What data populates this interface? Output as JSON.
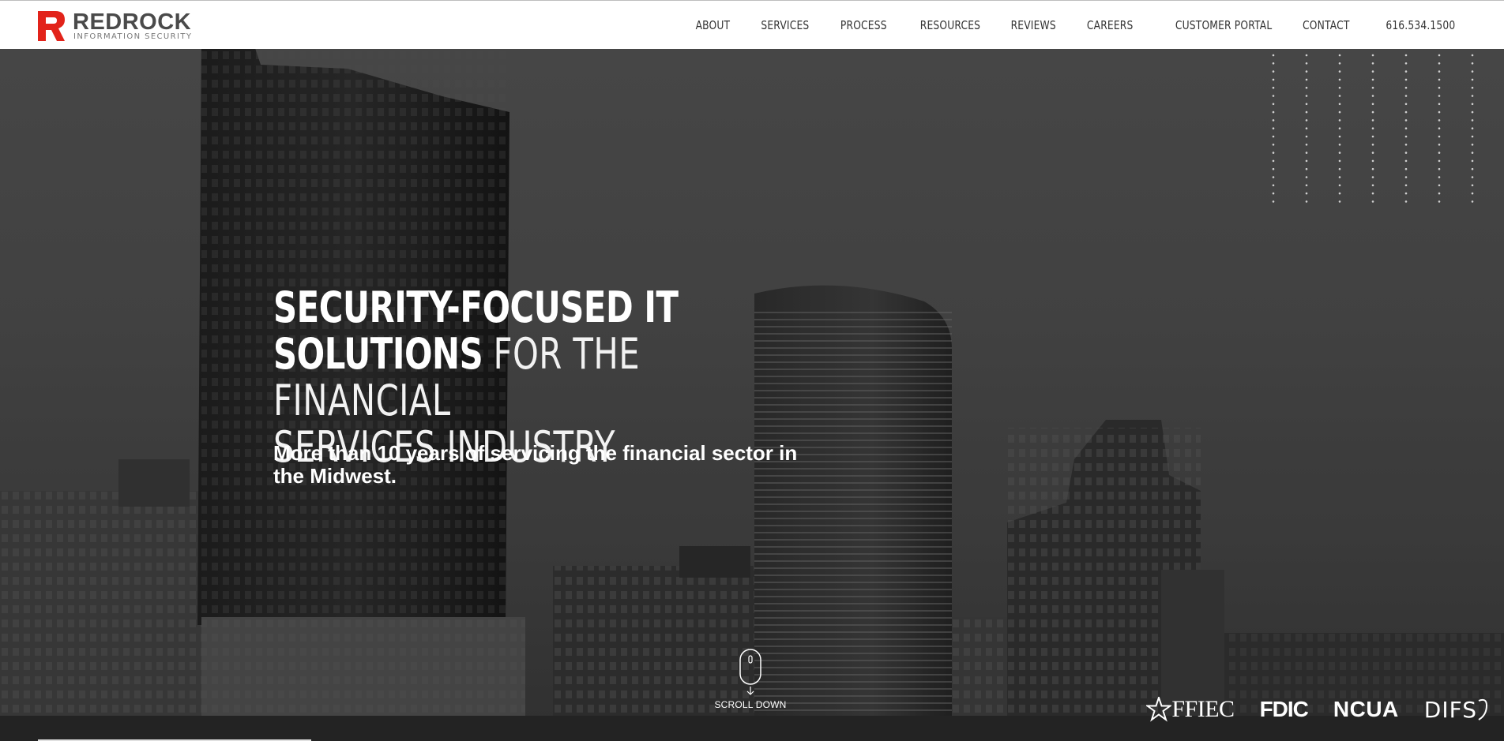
{
  "brand": {
    "name": "REDROCK",
    "tagline": "INFORMATION SECURITY",
    "accent_color": "#e2231a"
  },
  "nav": {
    "items": [
      {
        "label": "ABOUT"
      },
      {
        "label": "SERVICES"
      },
      {
        "label": "PROCESS"
      },
      {
        "label": "RESOURCES"
      },
      {
        "label": "REVIEWS"
      },
      {
        "label": "CAREERS"
      },
      {
        "label": "CUSTOMER PORTAL"
      },
      {
        "label": "CONTACT"
      },
      {
        "label": "616.534.1500"
      }
    ]
  },
  "hero": {
    "headline_bold_1": "SECURITY-FOCUSED IT",
    "headline_bold_2": "SOLUTIONS",
    "headline_light_1": "FOR THE FINANCIAL",
    "headline_light_2": "SERVICES INDUSTRY",
    "subheadline": "More than 10 years of servicing the financial sector in the Midwest.",
    "scroll_label": "SCROLL DOWN"
  },
  "partners": [
    {
      "name": "FFIEC",
      "icon": "star-icon"
    },
    {
      "name": "FDIC",
      "icon": "fdic-logo"
    },
    {
      "name": "NCUA",
      "icon": "ncua-logo"
    },
    {
      "name": "DIFS",
      "icon": "difs-logo"
    }
  ]
}
